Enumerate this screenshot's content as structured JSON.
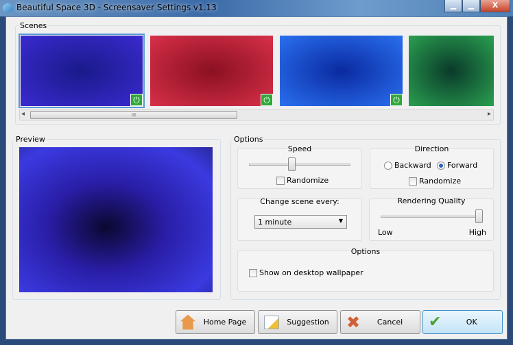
{
  "window": {
    "title": "Beautiful Space 3D - Screensaver Settings  v1.13",
    "minimize": "▁",
    "maximize": "□",
    "close": "X"
  },
  "scenes": {
    "label": "Scenes",
    "items": [
      {
        "colors": [
          "#1a1a8a",
          "#3a2ad0"
        ],
        "enabled": true,
        "selected": true
      },
      {
        "colors": [
          "#8a1020",
          "#d8304a"
        ],
        "enabled": true,
        "selected": false
      },
      {
        "colors": [
          "#0a2aa0",
          "#2a70f0"
        ],
        "enabled": true,
        "selected": false
      },
      {
        "colors": [
          "#0a3a2a",
          "#2aa050"
        ],
        "enabled": false,
        "selected": false
      }
    ],
    "power_icon": "⏻",
    "scroll_grip": "III",
    "scroll_left": "◂",
    "scroll_right": "▸"
  },
  "preview": {
    "label": "Preview"
  },
  "options": {
    "label": "Options",
    "speed": {
      "label": "Speed",
      "value_percent": 42,
      "randomize": "Randomize",
      "randomize_checked": false
    },
    "direction": {
      "label": "Direction",
      "backward": "Backward",
      "forward": "Forward",
      "selected": "Forward",
      "randomize": "Randomize",
      "randomize_checked": false
    },
    "change_scene": {
      "label": "Change scene every:",
      "value": "1 minute"
    },
    "quality": {
      "label": "Rendering Quality",
      "low": "Low",
      "high": "High",
      "value_percent": 100
    },
    "extra": {
      "label": "Options",
      "wallpaper": "Show on desktop wallpaper",
      "wallpaper_checked": false
    }
  },
  "buttons": {
    "home": "Home Page",
    "suggestion": "Suggestion",
    "cancel": "Cancel",
    "ok": "OK"
  }
}
